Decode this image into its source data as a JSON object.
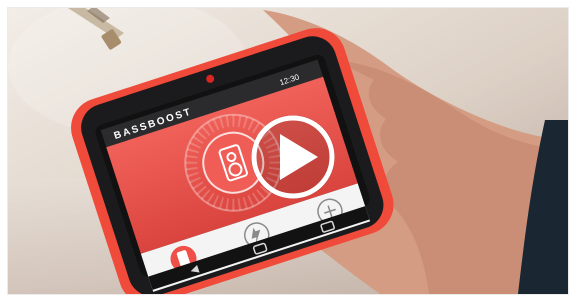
{
  "video": {
    "app_title": "BASSBOOST",
    "status_time": "12:30",
    "controls": [
      "",
      "",
      ""
    ],
    "play_icon": "play-icon",
    "accent_color": "#e84e45",
    "phone_color": "#f04a3a",
    "play_button_color": "#ffffff"
  }
}
